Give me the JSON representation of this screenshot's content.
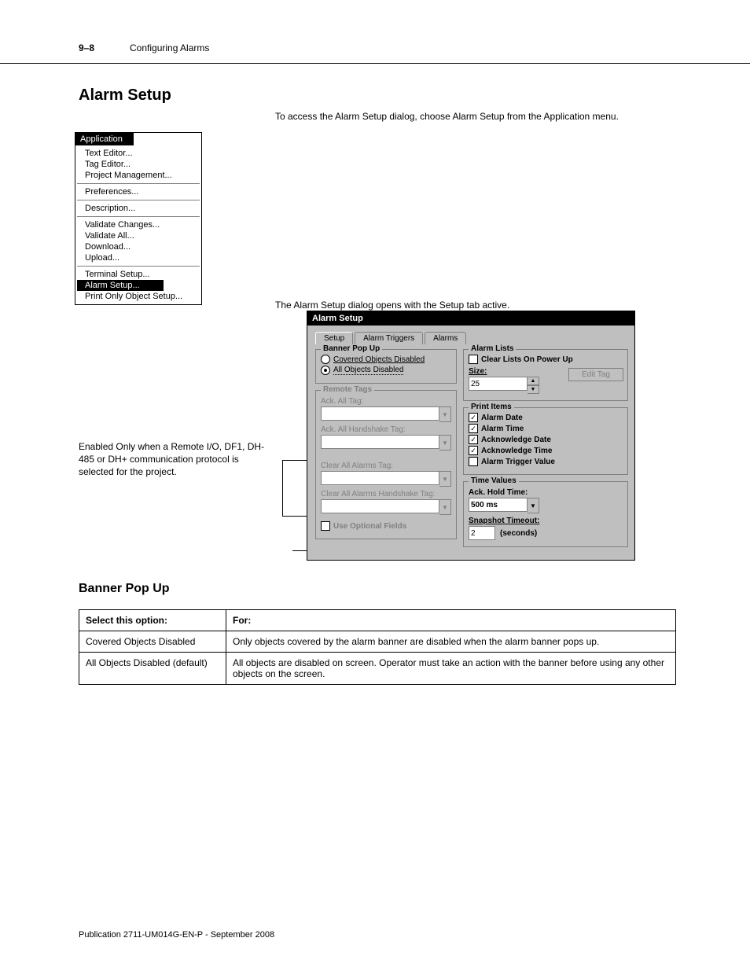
{
  "doc": {
    "section_num": "9–8",
    "section_title": "Configuring Alarms",
    "page_label_left": "Publication 2711-UM014G-EN-P - September 2008",
    "page_label_right": ""
  },
  "heading1": "Alarm Setup",
  "heading1_para": "To access the Alarm Setup dialog, choose Alarm Setup from the Application menu.",
  "app_menu": {
    "title": "Application",
    "items": [
      {
        "label": "Text Editor...",
        "sep": false
      },
      {
        "label": "Tag Editor...",
        "sep": false
      },
      {
        "label": "Project Management...",
        "sep": false
      },
      {
        "label": "",
        "sep": true
      },
      {
        "label": "Preferences...",
        "sep": false
      },
      {
        "label": "",
        "sep": true
      },
      {
        "label": "Description...",
        "sep": false
      },
      {
        "label": "",
        "sep": true
      },
      {
        "label": "Validate Changes...",
        "sep": false
      },
      {
        "label": "Validate All...",
        "sep": false
      },
      {
        "label": "Download...",
        "sep": false
      },
      {
        "label": "Upload...",
        "sep": false
      },
      {
        "label": "",
        "sep": true
      },
      {
        "label": "Terminal Setup...",
        "sep": false
      },
      {
        "label": "Alarm Setup...",
        "sep": false,
        "selected": true
      },
      {
        "label": "Print Only Object Setup...",
        "sep": false
      }
    ]
  },
  "para2": "The Alarm Setup dialog opens with the Setup tab active.",
  "dialog": {
    "title": "Alarm Setup",
    "tabs": [
      "Setup",
      "Alarm Triggers",
      "Alarms"
    ],
    "active_tab": "Setup",
    "edit_tag_btn": "Edit Tag",
    "banner": {
      "legend": "Banner Pop Up",
      "opt_covered": "Covered Objects Disabled",
      "opt_all": "All Objects Disabled",
      "selected": "all"
    },
    "remote": {
      "legend": "Remote Tags",
      "ack_all": "Ack. All Tag:",
      "ack_hand": "Ack. All Handshake Tag:",
      "clr_all": "Clear All Alarms Tag:",
      "clr_hand": "Clear All Alarms Handshake Tag:",
      "use_opt": "Use Optional Fields"
    },
    "alarm_lists": {
      "legend": "Alarm Lists",
      "clear_lists": "Clear Lists On Power Up",
      "size_label": "Size:",
      "size_value": "25"
    },
    "print": {
      "legend": "Print Items",
      "alarm_date": "Alarm Date",
      "alarm_time": "Alarm Time",
      "ack_date": "Acknowledge Date",
      "ack_time": "Acknowledge Time",
      "trigger": "Alarm Trigger Value"
    },
    "time": {
      "legend": "Time Values",
      "ack_hold": "Ack. Hold Time:",
      "ack_hold_val": "500 ms",
      "snap": "Snapshot Timeout:",
      "snap_val": "2",
      "snap_unit": "(seconds)"
    }
  },
  "callout_text": "Enabled Only when a Remote I/O, DF1, DH-485 or DH+ communication protocol is selected for the project.",
  "sub_heading": "Banner Pop Up",
  "table": {
    "head_a": "Select this option:",
    "head_b": "For:",
    "rows": [
      [
        "Covered Objects Disabled",
        "Only objects covered by the alarm banner are disabled when the alarm banner pops up."
      ],
      [
        "All Objects Disabled (default)",
        "All objects are disabled on screen. Operator must take an action with the banner before using any other objects on the screen."
      ]
    ]
  }
}
